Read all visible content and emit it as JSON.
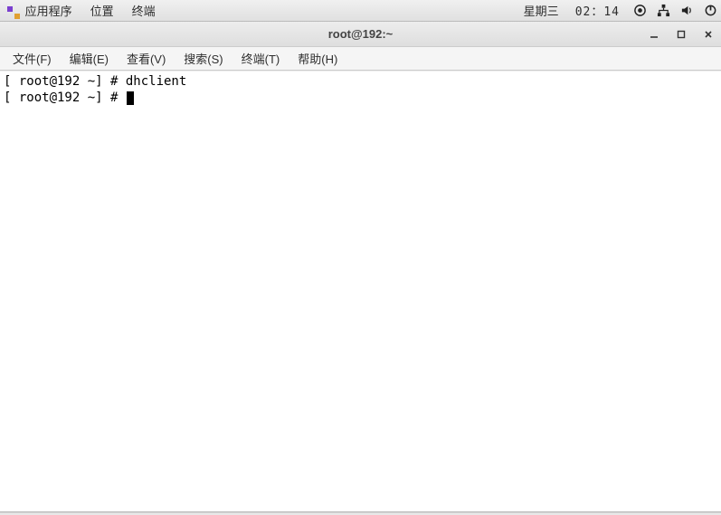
{
  "panel": {
    "apps": "应用程序",
    "places": "位置",
    "terminal": "终端",
    "day": "星期三",
    "time": "02：14"
  },
  "window": {
    "title": "root@192:~"
  },
  "menubar": {
    "file": "文件(F)",
    "edit": "编辑(E)",
    "view": "查看(V)",
    "search": "搜索(S)",
    "terminal": "终端(T)",
    "help": "帮助(H)"
  },
  "terminal": {
    "line1_prompt": "[ root@192 ~] # ",
    "line1_cmd": "dhclient",
    "line2_prompt": "[ root@192 ~] # "
  }
}
